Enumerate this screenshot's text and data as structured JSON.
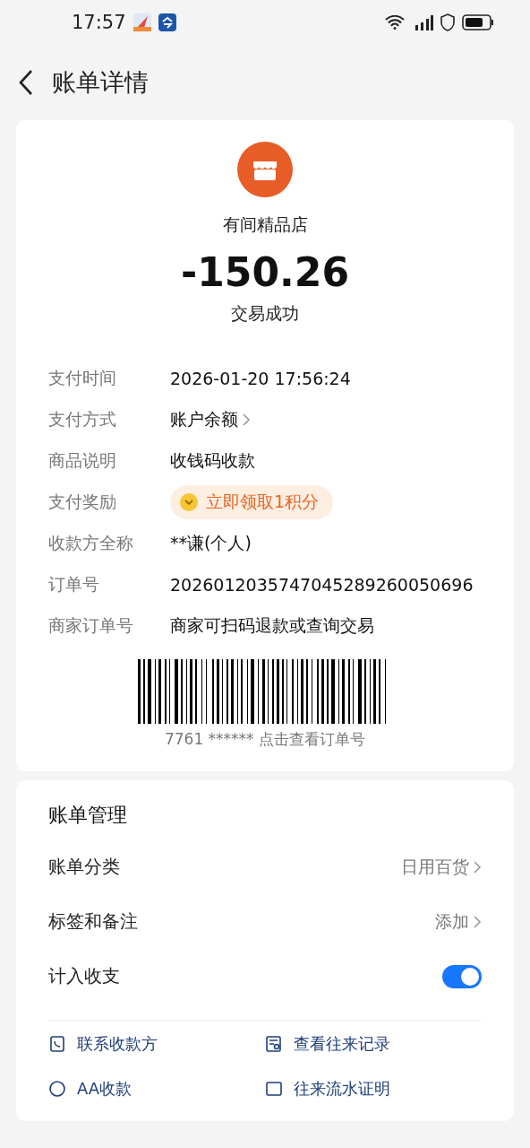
{
  "status_bar": {
    "time": "17:57"
  },
  "header": {
    "title": "账单详情"
  },
  "merchant": {
    "name": "有间精品店",
    "amount": "-150.26",
    "status": "交易成功"
  },
  "details": [
    {
      "label": "支付时间",
      "value": "2026-01-20 17:56:24",
      "kind": "text"
    },
    {
      "label": "支付方式",
      "value": "账户余额",
      "kind": "link"
    },
    {
      "label": "商品说明",
      "value": "收钱码收款",
      "kind": "text"
    },
    {
      "label": "支付奖励",
      "value": "立即领取1积分",
      "kind": "reward"
    },
    {
      "label": "收款方全称",
      "value": "**谦(个人)",
      "kind": "text"
    },
    {
      "label": "订单号",
      "value": "2026012035747045289260050696",
      "kind": "text"
    },
    {
      "label": "商家订单号",
      "value": "商家可扫码退款或查询交易",
      "kind": "text"
    }
  ],
  "barcode": {
    "caption": "7761 ****** 点击查看订单号"
  },
  "management": {
    "title": "账单管理",
    "rows": [
      {
        "label": "账单分类",
        "value": "日用百货",
        "kind": "link"
      },
      {
        "label": "标签和备注",
        "value": "添加",
        "kind": "link"
      },
      {
        "label": "计入收支",
        "kind": "toggle",
        "on": true
      }
    ]
  },
  "actions": [
    {
      "label": "联系收款方",
      "kind": "phone"
    },
    {
      "label": "查看往来记录",
      "kind": "doc"
    },
    {
      "label": "AA收款",
      "kind": "aa"
    },
    {
      "label": "往来流水证明",
      "kind": "cert"
    }
  ]
}
